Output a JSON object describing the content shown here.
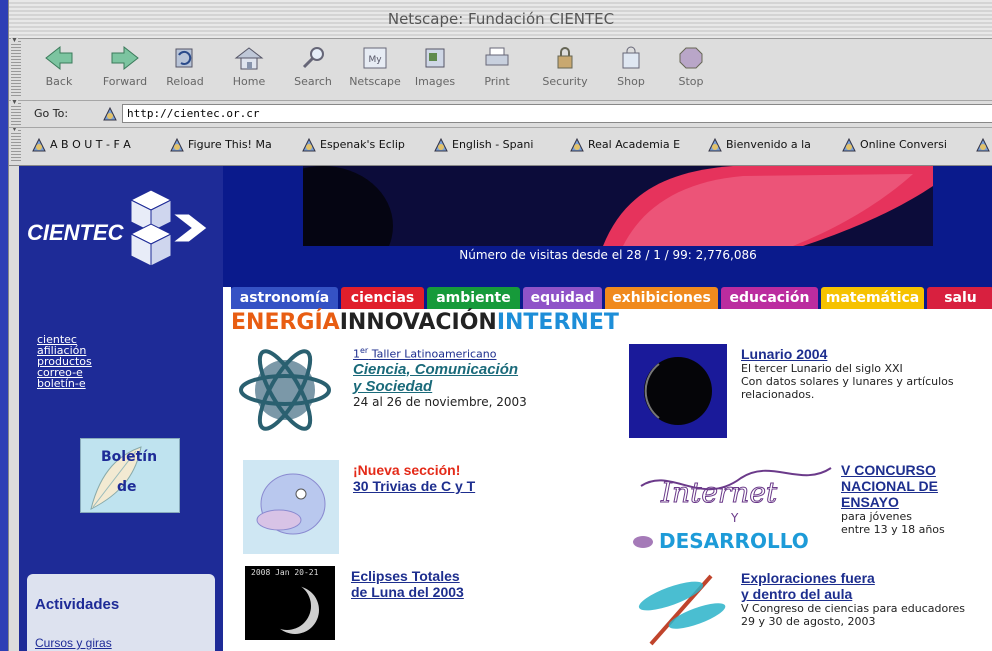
{
  "window": {
    "title": "Netscape: Fundación CIENTEC"
  },
  "toolbar": [
    {
      "label": "Back"
    },
    {
      "label": "Forward"
    },
    {
      "label": "Reload"
    },
    {
      "label": "Home"
    },
    {
      "label": "Search"
    },
    {
      "label": "Netscape"
    },
    {
      "label": "Images"
    },
    {
      "label": "Print"
    },
    {
      "label": "Security"
    },
    {
      "label": "Shop"
    },
    {
      "label": "Stop"
    }
  ],
  "location": {
    "label": "Go To:",
    "url": "http://cientec.or.cr"
  },
  "bookmarks": [
    "A B O U T - F A",
    "Figure This! Ma",
    "Espenak's Eclip",
    "English - Spani",
    "Real Academia E",
    "Bienvenido a la",
    "Online Conversi"
  ],
  "site": {
    "logo_text": "CIENTEC",
    "visits": "Número de visitas desde el 28 / 1 / 99:  2,776,086",
    "tabs": [
      {
        "label": "astronomía",
        "color": "#3552c4"
      },
      {
        "label": "ciencias",
        "color": "#e01f2b"
      },
      {
        "label": "ambiente",
        "color": "#169a3a"
      },
      {
        "label": "equidad",
        "color": "#8f53c8"
      },
      {
        "label": "exhibiciones",
        "color": "#f08a1d"
      },
      {
        "label": "educación",
        "color": "#bb2c9f"
      },
      {
        "label": "matemática",
        "color": "#f6c200"
      },
      {
        "label": "salu",
        "color": "#d8203f"
      }
    ],
    "headline": {
      "a": "ENERGÍA",
      "b": "INNOVACIÓN",
      "c": "INTERNET"
    },
    "left_links": [
      "cientec",
      "afiliación",
      "productos",
      "correo-e",
      "boletín-e"
    ],
    "boletin": {
      "title": "Boletín",
      "sub": "de"
    },
    "actividades": {
      "title": "Actividades",
      "item": "Cursos y giras"
    },
    "items": {
      "taller": {
        "sup": "er",
        "num": "1",
        "line1": "Taller Latinoamericano",
        "title1": "Ciencia, Comunicación",
        "title2": "y Sociedad",
        "date": "24 al 26 de noviembre, 2003"
      },
      "lunario": {
        "title": "Lunario 2004",
        "desc1": "El tercer Lunario del siglo XXI",
        "desc2": "Con datos solares y lunares y artículos",
        "desc3": "relacionados."
      },
      "trivias": {
        "new": "¡Nueva sección!",
        "title": "30 Trivias de C y T"
      },
      "concurso": {
        "t1": "V CONCURSO",
        "t2": "NACIONAL DE",
        "t3": "ENSAYO",
        "d1": "para jóvenes",
        "d2": "entre 13 y 18 años",
        "art1": "Internet",
        "art2": "Y",
        "art3": "DESARROLLO"
      },
      "eclipses": {
        "t1": "Eclipses Totales",
        "t2": "de Luna del 2003",
        "img_label": "2008 Jan 20-21"
      },
      "exploraciones": {
        "t1": "Exploraciones fuera",
        "t2": "y dentro del aula",
        "d1": "V Congreso de ciencias para educadores",
        "d2": "29 y 30 de agosto, 2003"
      }
    }
  }
}
